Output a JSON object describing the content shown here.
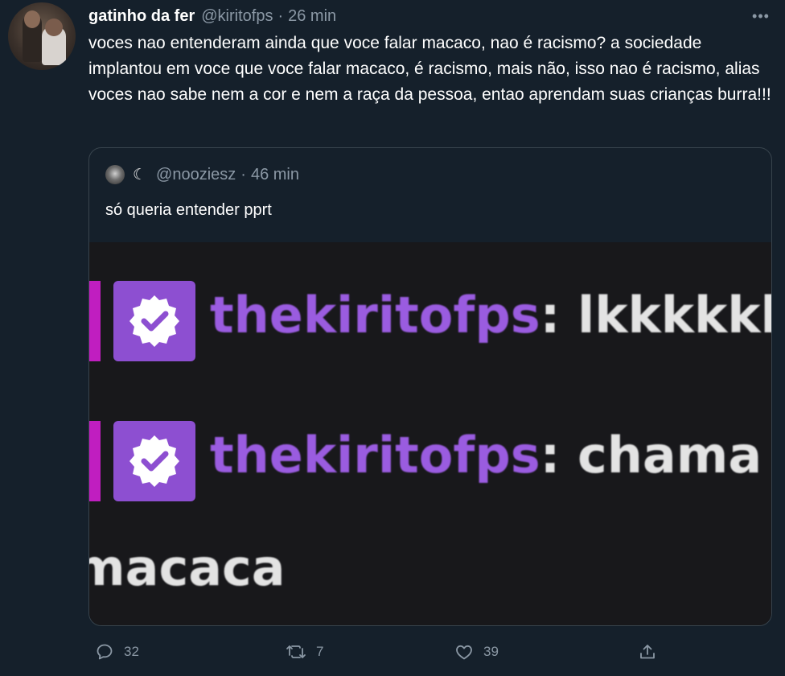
{
  "tweet": {
    "display_name": "gatinho da fer",
    "handle": "@kiritofps",
    "separator": "·",
    "time": "26 min",
    "more_label": "•••",
    "text": "voces nao entenderam ainda que voce falar macaco, nao é racismo? a sociedade implantou em voce que voce falar macaco, é racismo, mais não, isso nao é racismo, alias voces nao sabe nem a cor e nem a raça da pessoa, entao aprendam suas crianças burra!!!"
  },
  "quote": {
    "name_glyph": "☾",
    "handle": "@nooziesz",
    "separator": "·",
    "time": "46 min",
    "text": "só queria entender pprt",
    "media": {
      "lines": [
        {
          "user": "thekiritofps",
          "separator": ": ",
          "message": "lkkkkkk"
        },
        {
          "user": "thekiritofps",
          "separator": ": ",
          "message": "chama"
        }
      ],
      "wrap_text": "macaca"
    }
  },
  "actions": {
    "replies": "32",
    "retweets": "7",
    "likes": "39"
  },
  "colors": {
    "background": "#15202b",
    "muted": "#8b98a5",
    "border": "#38444d",
    "chat_user": "#9a5ce0",
    "badge": "#8d4fd1",
    "accent_bar": "#c01ec0"
  },
  "icons": [
    "more-icon",
    "reply-icon",
    "retweet-icon",
    "like-icon",
    "share-icon",
    "verified-check-icon",
    "moon-icon"
  ]
}
